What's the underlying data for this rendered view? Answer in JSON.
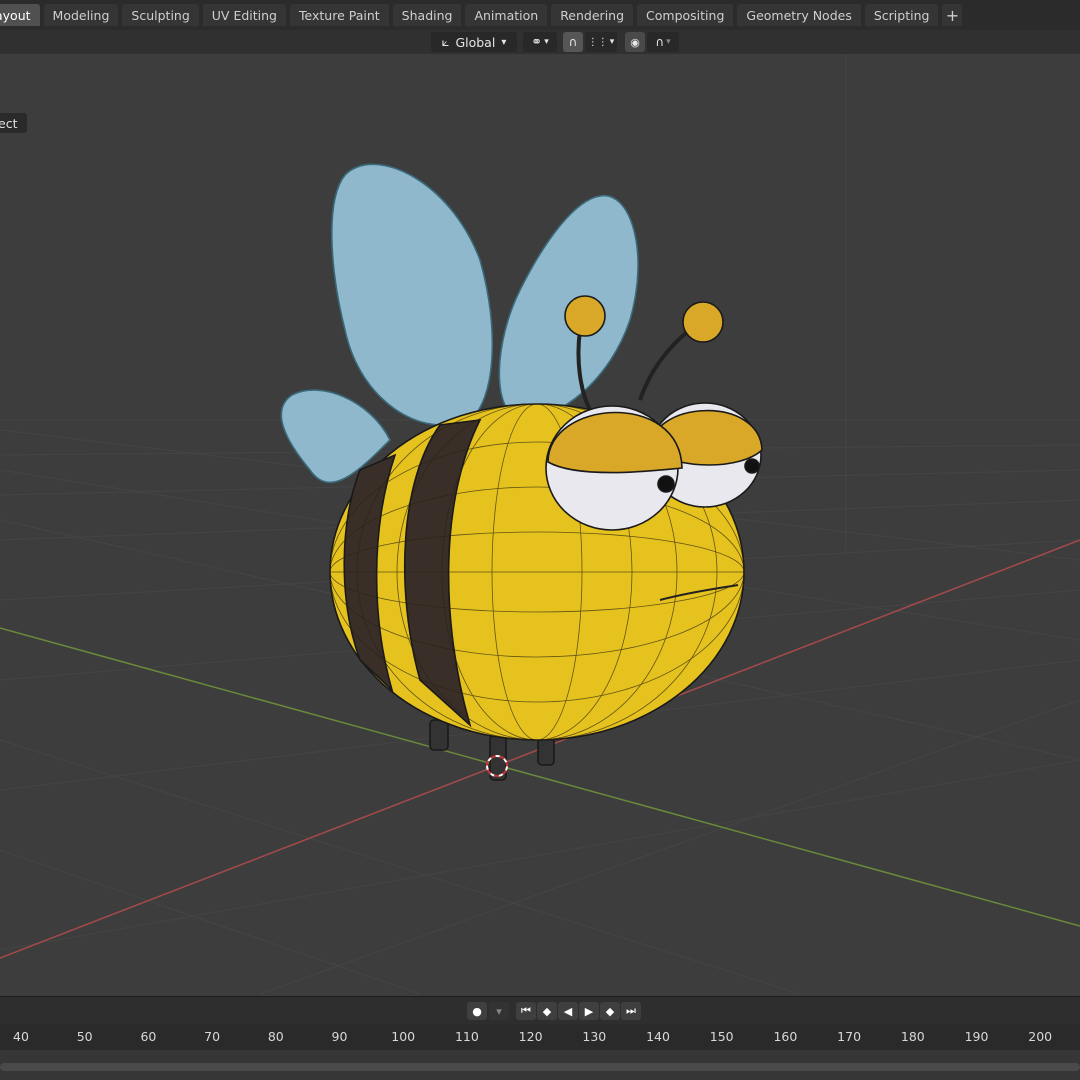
{
  "workspace_tabs": [
    "Layout",
    "Modeling",
    "Sculpting",
    "UV Editing",
    "Texture Paint",
    "Shading",
    "Animation",
    "Rendering",
    "Compositing",
    "Geometry Nodes",
    "Scripting"
  ],
  "workspace_tabs_display": [
    "ayout",
    "Modeling",
    "Sculpting",
    "UV Editing",
    "Texture Paint",
    "Shading",
    "Animation",
    "Rendering",
    "Compositing",
    "Geometry Nodes",
    "Scripting"
  ],
  "active_tab": "Layout",
  "add_tab_label": "+",
  "viewport_header": {
    "orientation": "Global",
    "dropdown_arrow": "⌄"
  },
  "mode_label": "ect",
  "timeline": {
    "ticks": [
      "40",
      "50",
      "60",
      "70",
      "80",
      "90",
      "100",
      "110",
      "120",
      "130",
      "140",
      "150",
      "160",
      "170",
      "180",
      "190",
      "200"
    ]
  },
  "colors": {
    "x_axis": "#a54a4a",
    "y_axis": "#6a8a3a",
    "bee_yellow": "#e6c21e",
    "bee_stripe": "#3a2e28",
    "wing_blue": "#8fb8cc"
  }
}
